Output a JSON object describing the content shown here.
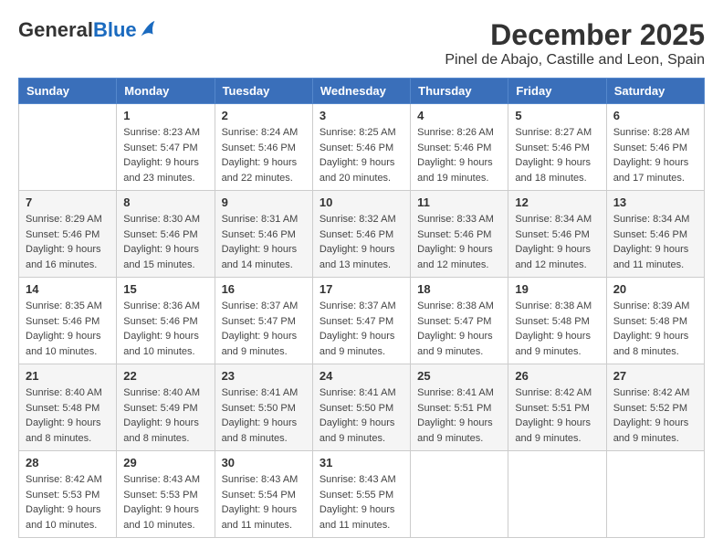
{
  "header": {
    "logo_general": "General",
    "logo_blue": "Blue",
    "month": "December 2025",
    "location": "Pinel de Abajo, Castille and Leon, Spain"
  },
  "weekdays": [
    "Sunday",
    "Monday",
    "Tuesday",
    "Wednesday",
    "Thursday",
    "Friday",
    "Saturday"
  ],
  "weeks": [
    [
      {
        "day": "",
        "info": ""
      },
      {
        "day": "1",
        "info": "Sunrise: 8:23 AM\nSunset: 5:47 PM\nDaylight: 9 hours\nand 23 minutes."
      },
      {
        "day": "2",
        "info": "Sunrise: 8:24 AM\nSunset: 5:46 PM\nDaylight: 9 hours\nand 22 minutes."
      },
      {
        "day": "3",
        "info": "Sunrise: 8:25 AM\nSunset: 5:46 PM\nDaylight: 9 hours\nand 20 minutes."
      },
      {
        "day": "4",
        "info": "Sunrise: 8:26 AM\nSunset: 5:46 PM\nDaylight: 9 hours\nand 19 minutes."
      },
      {
        "day": "5",
        "info": "Sunrise: 8:27 AM\nSunset: 5:46 PM\nDaylight: 9 hours\nand 18 minutes."
      },
      {
        "day": "6",
        "info": "Sunrise: 8:28 AM\nSunset: 5:46 PM\nDaylight: 9 hours\nand 17 minutes."
      }
    ],
    [
      {
        "day": "7",
        "info": "Sunrise: 8:29 AM\nSunset: 5:46 PM\nDaylight: 9 hours\nand 16 minutes."
      },
      {
        "day": "8",
        "info": "Sunrise: 8:30 AM\nSunset: 5:46 PM\nDaylight: 9 hours\nand 15 minutes."
      },
      {
        "day": "9",
        "info": "Sunrise: 8:31 AM\nSunset: 5:46 PM\nDaylight: 9 hours\nand 14 minutes."
      },
      {
        "day": "10",
        "info": "Sunrise: 8:32 AM\nSunset: 5:46 PM\nDaylight: 9 hours\nand 13 minutes."
      },
      {
        "day": "11",
        "info": "Sunrise: 8:33 AM\nSunset: 5:46 PM\nDaylight: 9 hours\nand 12 minutes."
      },
      {
        "day": "12",
        "info": "Sunrise: 8:34 AM\nSunset: 5:46 PM\nDaylight: 9 hours\nand 12 minutes."
      },
      {
        "day": "13",
        "info": "Sunrise: 8:34 AM\nSunset: 5:46 PM\nDaylight: 9 hours\nand 11 minutes."
      }
    ],
    [
      {
        "day": "14",
        "info": "Sunrise: 8:35 AM\nSunset: 5:46 PM\nDaylight: 9 hours\nand 10 minutes."
      },
      {
        "day": "15",
        "info": "Sunrise: 8:36 AM\nSunset: 5:46 PM\nDaylight: 9 hours\nand 10 minutes."
      },
      {
        "day": "16",
        "info": "Sunrise: 8:37 AM\nSunset: 5:47 PM\nDaylight: 9 hours\nand 9 minutes."
      },
      {
        "day": "17",
        "info": "Sunrise: 8:37 AM\nSunset: 5:47 PM\nDaylight: 9 hours\nand 9 minutes."
      },
      {
        "day": "18",
        "info": "Sunrise: 8:38 AM\nSunset: 5:47 PM\nDaylight: 9 hours\nand 9 minutes."
      },
      {
        "day": "19",
        "info": "Sunrise: 8:38 AM\nSunset: 5:48 PM\nDaylight: 9 hours\nand 9 minutes."
      },
      {
        "day": "20",
        "info": "Sunrise: 8:39 AM\nSunset: 5:48 PM\nDaylight: 9 hours\nand 8 minutes."
      }
    ],
    [
      {
        "day": "21",
        "info": "Sunrise: 8:40 AM\nSunset: 5:48 PM\nDaylight: 9 hours\nand 8 minutes."
      },
      {
        "day": "22",
        "info": "Sunrise: 8:40 AM\nSunset: 5:49 PM\nDaylight: 9 hours\nand 8 minutes."
      },
      {
        "day": "23",
        "info": "Sunrise: 8:41 AM\nSunset: 5:50 PM\nDaylight: 9 hours\nand 8 minutes."
      },
      {
        "day": "24",
        "info": "Sunrise: 8:41 AM\nSunset: 5:50 PM\nDaylight: 9 hours\nand 9 minutes."
      },
      {
        "day": "25",
        "info": "Sunrise: 8:41 AM\nSunset: 5:51 PM\nDaylight: 9 hours\nand 9 minutes."
      },
      {
        "day": "26",
        "info": "Sunrise: 8:42 AM\nSunset: 5:51 PM\nDaylight: 9 hours\nand 9 minutes."
      },
      {
        "day": "27",
        "info": "Sunrise: 8:42 AM\nSunset: 5:52 PM\nDaylight: 9 hours\nand 9 minutes."
      }
    ],
    [
      {
        "day": "28",
        "info": "Sunrise: 8:42 AM\nSunset: 5:53 PM\nDaylight: 9 hours\nand 10 minutes."
      },
      {
        "day": "29",
        "info": "Sunrise: 8:43 AM\nSunset: 5:53 PM\nDaylight: 9 hours\nand 10 minutes."
      },
      {
        "day": "30",
        "info": "Sunrise: 8:43 AM\nSunset: 5:54 PM\nDaylight: 9 hours\nand 11 minutes."
      },
      {
        "day": "31",
        "info": "Sunrise: 8:43 AM\nSunset: 5:55 PM\nDaylight: 9 hours\nand 11 minutes."
      },
      {
        "day": "",
        "info": ""
      },
      {
        "day": "",
        "info": ""
      },
      {
        "day": "",
        "info": ""
      }
    ]
  ]
}
